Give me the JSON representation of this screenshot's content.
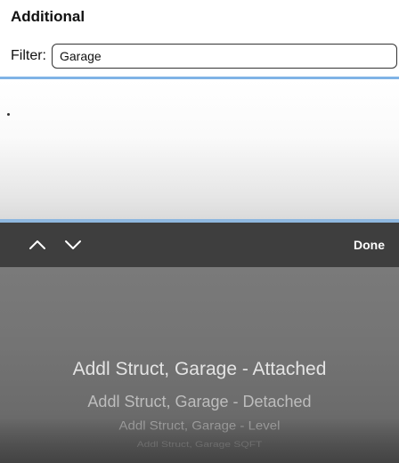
{
  "section": {
    "title": "Additional"
  },
  "filter": {
    "label": "Filter:",
    "value": "Garage"
  },
  "toolbar": {
    "prev_icon": "chevron-up-icon",
    "next_icon": "chevron-down-icon",
    "done_label": "Done"
  },
  "picker": {
    "items": [
      "Addl Struct, Garage - Attached",
      "Addl Struct, Garage - Detached",
      "Addl Struct, Garage - Level",
      "Addl Struct, Garage SQFT"
    ],
    "selected": "Addl Struct, Garage - Attached"
  },
  "colors": {
    "toolbar_bg": "#3e3e3e",
    "picker_bg": "#747474",
    "divider_blue": "#7fb3e6"
  }
}
